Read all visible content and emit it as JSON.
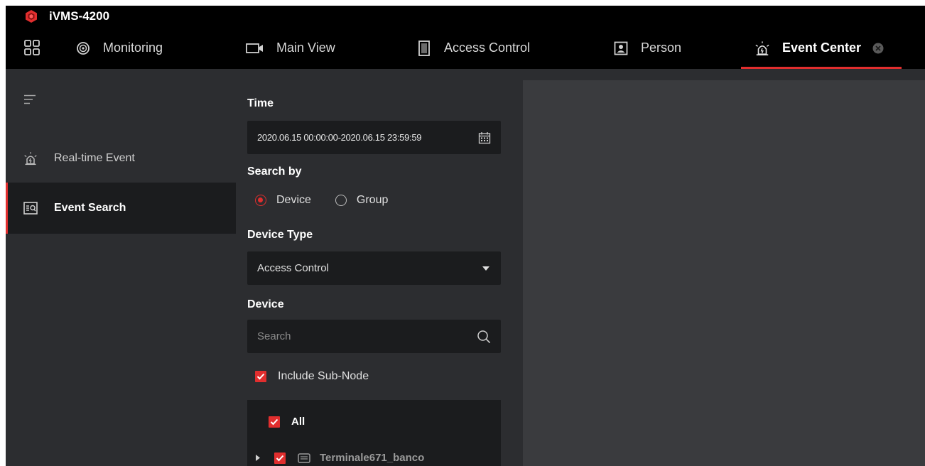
{
  "app": {
    "title": "iVMS-4200",
    "brand_color": "#e12e2e"
  },
  "tabs": [
    {
      "label": "Monitoring",
      "icon": "monitoring-icon"
    },
    {
      "label": "Main View",
      "icon": "main-view-icon"
    },
    {
      "label": "Access Control",
      "icon": "access-control-icon"
    },
    {
      "label": "Person",
      "icon": "person-icon"
    },
    {
      "label": "Event Center",
      "icon": "alarm-icon",
      "active": true
    }
  ],
  "sidebar": {
    "items": [
      {
        "label": "Real-time Event",
        "icon": "alarm-icon"
      },
      {
        "label": "Event Search",
        "icon": "event-search-icon",
        "active": true
      }
    ]
  },
  "search": {
    "time_label": "Time",
    "time_value": "2020.06.15 00:00:00-2020.06.15 23:59:59",
    "search_by_label": "Search by",
    "search_by_options": [
      "Device",
      "Group"
    ],
    "search_by_selected": "Device",
    "device_type_label": "Device Type",
    "device_type_value": "Access Control",
    "device_label": "Device",
    "device_search_placeholder": "Search",
    "include_sub_node_label": "Include Sub-Node",
    "include_sub_node_checked": true,
    "tree": {
      "all_label": "All",
      "all_checked": true,
      "nodes": [
        {
          "label": "Terminale671_banco",
          "checked": true
        }
      ]
    }
  }
}
